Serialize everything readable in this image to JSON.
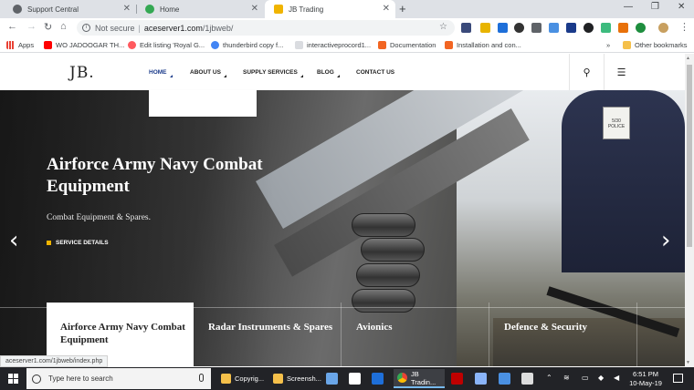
{
  "browser": {
    "tabs": [
      {
        "title": "Support Central",
        "favicon_color": "#5f6368"
      },
      {
        "title": "Home",
        "favicon_color": "#34a853"
      },
      {
        "title": "JB Trading",
        "favicon_color": "#f0b400"
      }
    ],
    "window_controls": [
      "—",
      "❐",
      "✕"
    ],
    "address": {
      "security": "Not secure",
      "host": "aceserver1.com",
      "path": "/1jbweb/"
    },
    "bookmarks": [
      {
        "label": "Apps",
        "color": "#e94235"
      },
      {
        "label": "WO JADOOGAR TH...",
        "color": "#ff0000"
      },
      {
        "label": "Edit listing 'Royal G...",
        "color": "#ff5a5f"
      },
      {
        "label": "thunderbird copy f...",
        "color": "#4285f4"
      },
      {
        "label": "interactiveprocord1...",
        "color": "#5f6368"
      },
      {
        "label": "Documentation",
        "color": "#f26522"
      },
      {
        "label": "Installation and con...",
        "color": "#f26522"
      }
    ],
    "bookmarks_overflow": "»",
    "other_bookmarks": "Other bookmarks"
  },
  "site": {
    "logo": "JB.",
    "nav": [
      {
        "label": "HOME",
        "current": true
      },
      {
        "label": "ABOUT US",
        "current": false
      },
      {
        "label": "SUPPLY SERVICES",
        "current": false
      },
      {
        "label": "BLOG",
        "current": false
      },
      {
        "label": "CONTACT US",
        "current": false
      }
    ],
    "hero": {
      "title": "Airforce Army Navy Combat Equipment",
      "subtitle": "Combat Equipment & Spares.",
      "cta": "SERVICE DETAILS",
      "badge_text": "5/30 POLICE"
    },
    "services": [
      {
        "label": "Airforce Army Navy Combat Equipment",
        "active": true
      },
      {
        "label": "Radar Instruments & Spares",
        "active": false
      },
      {
        "label": "Avionics",
        "active": false
      },
      {
        "label": "Defence & Security",
        "active": false
      }
    ]
  },
  "status_url": "aceserver1.com/1jbweb/index.php",
  "taskbar": {
    "search_placeholder": "Type here to search",
    "items": [
      {
        "label": "Copyrig...",
        "active": false
      },
      {
        "label": "Screensh...",
        "active": false
      },
      {
        "label": "JB Tradin...",
        "active": true
      }
    ],
    "time": "6:51 PM",
    "date": "10-May-19"
  },
  "colors": {
    "accent": "#1a3a8a",
    "cta_square": "#f0b400"
  }
}
